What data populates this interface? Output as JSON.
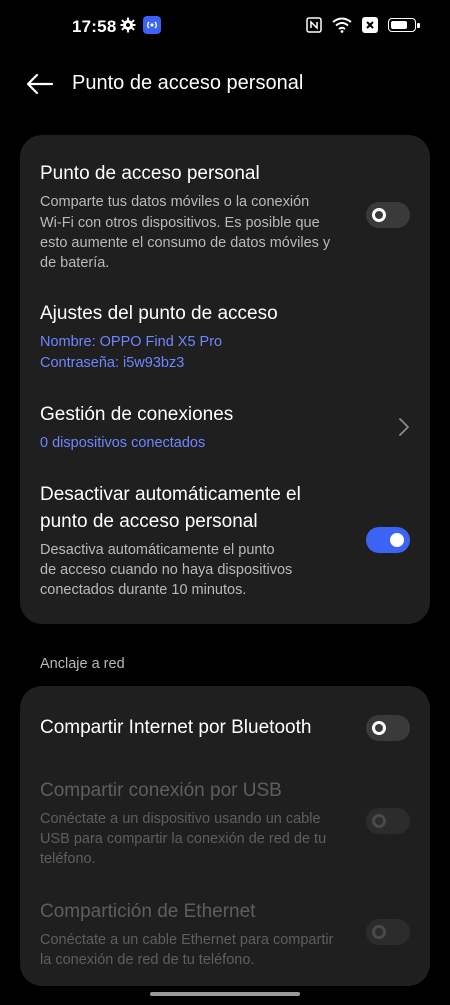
{
  "status_bar": {
    "time": "17:58",
    "icons": [
      "gear-icon",
      "hotspot-icon",
      "nfc-icon",
      "wifi-icon",
      "sim-x-icon",
      "battery-icon"
    ]
  },
  "header": {
    "title": "Punto de acceso personal",
    "back_icon": "back-arrow-icon"
  },
  "card1": {
    "hotspot": {
      "title": "Punto de acceso personal",
      "desc1": "Comparte tus datos móviles o la conexión",
      "desc2": "Wi-Fi con otros dispositivos. Es posible que",
      "desc3": "esto aumente el consumo de datos móviles y",
      "desc4": "de batería.",
      "enabled": false
    },
    "settings": {
      "title": "Ajustes del punto de acceso",
      "name": "Nombre: OPPO Find X5 Pro",
      "password": "Contraseña: i5w93bz3"
    },
    "connections": {
      "title": "Gestión de conexiones",
      "sub": "0 dispositivos conectados"
    },
    "auto_off": {
      "title1": "Desactivar automáticamente el",
      "title2": "punto de acceso personal",
      "desc1": "Desactiva automáticamente el punto",
      "desc2": "de acceso cuando no haya dispositivos",
      "desc3": "conectados durante 10 minutos.",
      "enabled": true
    }
  },
  "section": {
    "label": "Anclaje a red"
  },
  "card2": {
    "bluetooth": {
      "title": "Compartir Internet por Bluetooth",
      "enabled": false
    },
    "usb": {
      "title": "Compartir conexión por USB",
      "desc1": "Conéctate a un dispositivo usando un cable",
      "desc2": "USB para compartir la conexión de red de tu",
      "desc3": "teléfono.",
      "enabled": false
    },
    "ethernet": {
      "title": "Compartición de Ethernet",
      "desc1": "Conéctate a un cable Ethernet para compartir",
      "desc2": "la conexión de red de tu teléfono.",
      "enabled": false
    }
  },
  "colors": {
    "accent": "#3b63f4",
    "link": "#6e86ff",
    "card": "#1f1f1f",
    "background": "#000000"
  }
}
